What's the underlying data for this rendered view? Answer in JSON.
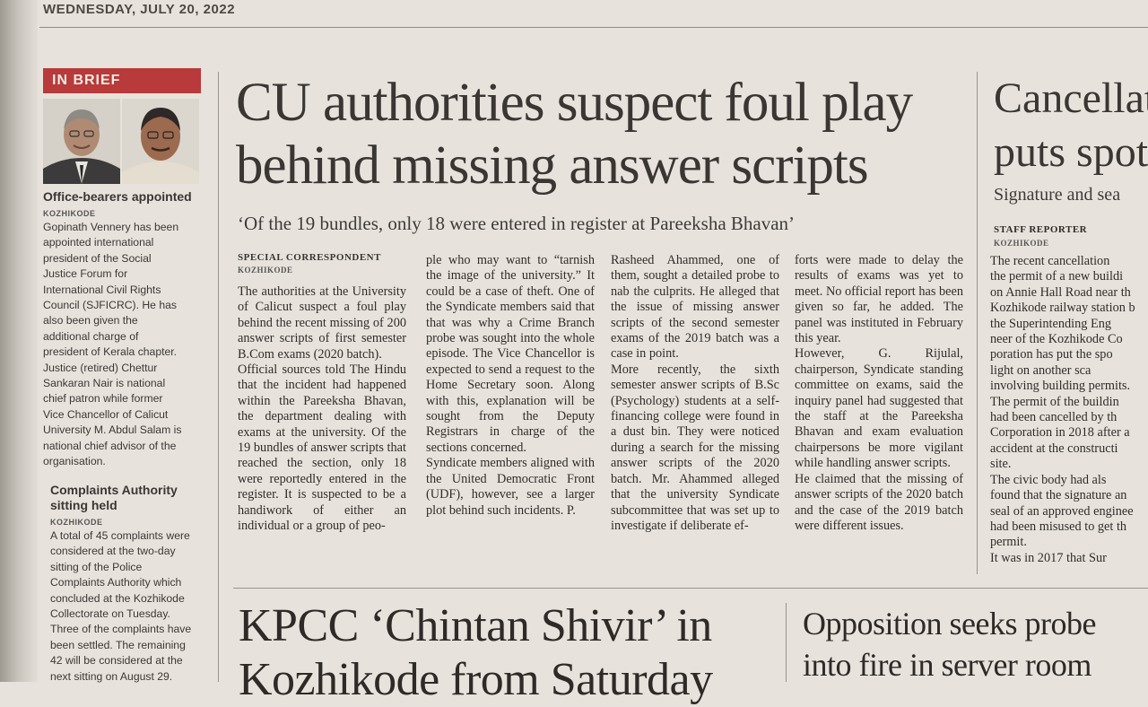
{
  "dateline": "WEDNESDAY, JULY 20, 2022",
  "in_brief": {
    "tag": "IN BRIEF",
    "photo_left_alt": "portrait photo",
    "photo_right_alt": "portrait photo",
    "item1": {
      "headline": "Office-bearers appointed",
      "place": "KOZHIKODE",
      "body": "Gopinath Vennery has been\nappointed international\npresident of the Social\nJustice Forum for\nInternational Civil Rights\nCouncil (SJFICRC). He has\nalso been given the\nadditional charge of\npresident of Kerala chapter.\nJustice (retired) Chettur\nSankaran Nair is national\nchief patron while former\nVice Chancellor of Calicut\nUniversity M. Abdul Salam is\nnational chief advisor of the\norganisation."
    },
    "item2": {
      "headline": "Complaints Authority\nsitting held",
      "place": "KOZHIKODE",
      "body": "A total of 45 complaints were\nconsidered at the two-day\nsitting of the Police\nComplaints Authority which\nconcluded at the Kozhikode\nCollectorate on Tuesday.\nThree of the complaints have\nbeen settled. The remaining\n42 will be considered at the\nnext sitting on August 29."
    }
  },
  "main_story": {
    "headline": "CU authorities suspect foul play\nbehind missing answer scripts",
    "deck": "‘Of the 19 bundles, only 18 were entered in register at Pareeksha Bhavan’",
    "byline": "SPECIAL CORRESPONDENT",
    "place": "KOZHIKODE",
    "col1": "The authorities at the University of Calicut suspect a foul play behind the recent missing of 200 answer scripts of first semester B.Com exams (2020 batch).\n    Official sources told The Hindu that the incident had happened within the Pareeksha Bhavan, the department dealing with exams at the university. Of the 19 bundles of answer scripts that reached the section, only 18 were reportedly entered in the register. It is suspected to be a handiwork of either an individual or a group of peo-",
    "col2": "ple who may want to “tarnish the image of the university.” It could be a case of theft. One of the Syndicate members said that that was why a Crime Branch probe was sought into the whole episode. The Vice Chancellor is expected to send a request to the Home Secretary soon. Along with this, explanation will be sought from the Deputy Registrars in charge of the sections concerned.\n    Syndicate members aligned with the United Democratic Front (UDF), however, see a larger plot behind such incidents. P.",
    "col3": "Rasheed Ahammed, one of them, sought a detailed probe to nab the culprits. He alleged that the issue of missing answer scripts of the second semester exams of the 2019 batch was a case in point.\n    More recently, the sixth semester answer scripts of B.Sc (Psychology) students at a self-financing college were found in a dust bin. They were noticed during a search for the missing answer scripts of the 2020 batch. Mr. Ahammed alleged that the university Syndicate subcommittee that was set up to investigate if deliberate ef-",
    "col4": "forts were made to delay the results of exams was yet to meet. No official report has been given so far, he added. The panel was instituted in February this year.\n    However, G. Rijulal, chairperson, Syndicate standing committee on exams, said the inquiry panel had suggested that the staff at the Pareeksha Bhavan and exam evaluation chairpersons be more vigilant while handling answer scripts.\n    He claimed that the missing of answer scripts of the 2020 batch and the case of the 2019 batch were different issues."
  },
  "right_story": {
    "headline": "Cancellat\nputs spot",
    "deck": "Signature and sea",
    "byline": "STAFF REPORTER",
    "place": "KOZHIKODE",
    "body": "The recent cancellation\nthe permit of a new buildi\non Annie Hall Road near th\nKozhikode railway station b\nthe Superintending Eng\nneer of the Kozhikode Co\nporation has put the spo\nlight on another sca\ninvolving building permits.\n  The permit of the buildin\nhad been cancelled by th\nCorporation in 2018 after a\naccident at the constructi\nsite.\n  The civic body had als\nfound that the signature an\nseal of an approved enginee\nhad been misused to get th\npermit.\n  It was in 2017 that Sur"
  },
  "bottom_left": {
    "headline": "KPCC ‘Chintan Shivir’ in\nKozhikode from Saturday"
  },
  "bottom_right": {
    "headline": "Opposition seeks probe\ninto fire in server room"
  }
}
